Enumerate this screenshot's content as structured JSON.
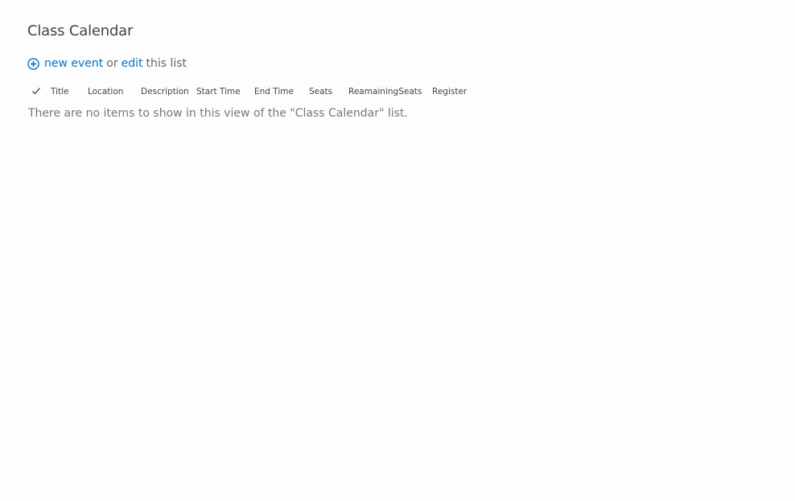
{
  "list": {
    "title": "Class Calendar"
  },
  "toolbar": {
    "new_label": "new event",
    "or_text": "or",
    "edit_label": "edit",
    "suffix_text": "this list"
  },
  "columns": [
    {
      "label": "Title"
    },
    {
      "label": "Location"
    },
    {
      "label": "Description"
    },
    {
      "label": "Start Time"
    },
    {
      "label": "End Time"
    },
    {
      "label": "Seats"
    },
    {
      "label": "ReamainingSeats"
    },
    {
      "label": "Register"
    }
  ],
  "empty_message": "There are no items to show in this view of the \"Class Calendar\" list.",
  "icons": {
    "add": "plus-circle-icon",
    "select_all": "checkmark-icon"
  },
  "colors": {
    "link": "#0072c6",
    "text": "#444444",
    "muted": "#777777",
    "background": "#fdfdfd"
  }
}
